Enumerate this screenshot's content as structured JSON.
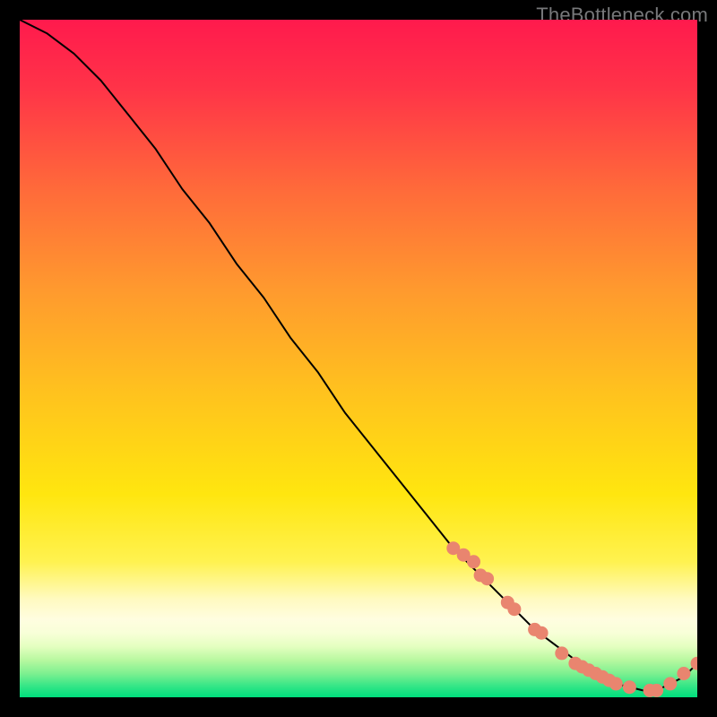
{
  "watermark": "TheBottleneck.com",
  "chart_data": {
    "type": "line",
    "title": "",
    "xlabel": "",
    "ylabel": "",
    "xlim": [
      0,
      100
    ],
    "ylim": [
      0,
      100
    ],
    "grid": false,
    "legend": false,
    "background_gradient": {
      "top_color": "#ff1a4d",
      "mid_color": "#ffd400",
      "bottom_color": "#00e07a",
      "description": "vertical red→yellow→green gradient with pale-yellow band near bottom"
    },
    "series": [
      {
        "name": "curve",
        "style": "solid-black-line",
        "x": [
          0,
          4,
          8,
          12,
          16,
          20,
          24,
          28,
          32,
          36,
          40,
          44,
          48,
          52,
          56,
          60,
          64,
          68,
          72,
          76,
          80,
          84,
          88,
          92,
          94,
          96,
          98,
          100
        ],
        "y": [
          100,
          98,
          95,
          91,
          86,
          81,
          75,
          70,
          64,
          59,
          53,
          48,
          42,
          37,
          32,
          27,
          22,
          18,
          14,
          10,
          7,
          4,
          2,
          1,
          1,
          2,
          3,
          5
        ]
      },
      {
        "name": "markers",
        "style": "salmon-dots",
        "x": [
          64,
          65.5,
          67,
          68,
          69,
          72,
          73,
          76,
          77,
          80,
          82,
          83,
          84,
          85,
          86,
          87,
          88,
          90,
          93,
          94,
          96,
          98,
          100
        ],
        "y": [
          22,
          21,
          20,
          18,
          17.5,
          14,
          13,
          10,
          9.5,
          6.5,
          5,
          4.5,
          4,
          3.5,
          3,
          2.5,
          2,
          1.5,
          1,
          1,
          2,
          3.5,
          5
        ]
      }
    ]
  }
}
